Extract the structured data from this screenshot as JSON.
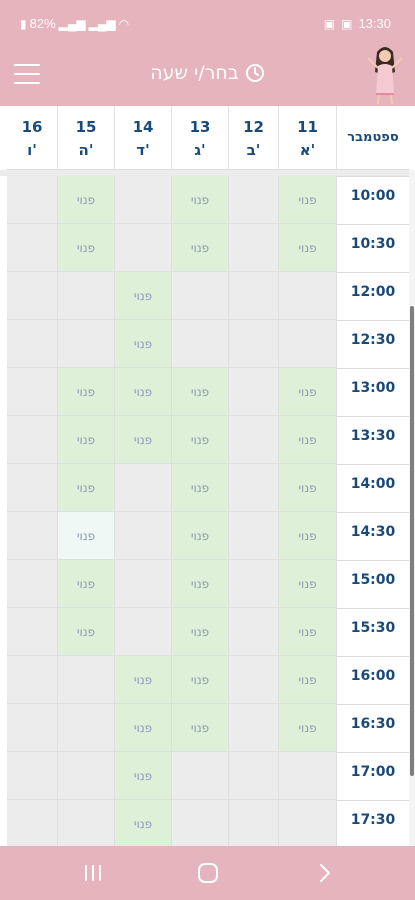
{
  "status_bar": {
    "battery": "82%",
    "clock": "13:30",
    "icons": [
      "battery-icon",
      "signal-icon",
      "signal-icon",
      "wifi-icon",
      "notification-icon",
      "image-icon"
    ]
  },
  "app_bar": {
    "title": "בחר/י שעה",
    "icons": [
      "menu-icon",
      "clock-icon",
      "avatar"
    ]
  },
  "calendar": {
    "month": "ספטמבר",
    "days": [
      {
        "num": "11",
        "day": "א'"
      },
      {
        "num": "12",
        "day": "ב'"
      },
      {
        "num": "13",
        "day": "ג'"
      },
      {
        "num": "14",
        "day": "ד'"
      },
      {
        "num": "15",
        "day": "ה'"
      },
      {
        "num": "16",
        "day": "ו'"
      }
    ],
    "free_label": "פנוי",
    "times": [
      "10:00",
      "10:30",
      "12:00",
      "12:30",
      "13:00",
      "13:30",
      "14:00",
      "14:30",
      "15:00",
      "15:30",
      "16:00",
      "16:30",
      "17:00",
      "17:30"
    ],
    "grid": [
      [
        1,
        0,
        1,
        0,
        1,
        0
      ],
      [
        1,
        0,
        1,
        0,
        1,
        0
      ],
      [
        0,
        0,
        0,
        1,
        0,
        0
      ],
      [
        0,
        0,
        0,
        1,
        0,
        0
      ],
      [
        1,
        0,
        1,
        1,
        1,
        0
      ],
      [
        1,
        0,
        1,
        1,
        1,
        0
      ],
      [
        1,
        0,
        1,
        0,
        1,
        0
      ],
      [
        1,
        0,
        1,
        0,
        2,
        0
      ],
      [
        1,
        0,
        1,
        0,
        1,
        0
      ],
      [
        1,
        0,
        1,
        0,
        1,
        0
      ],
      [
        1,
        0,
        1,
        1,
        0,
        0
      ],
      [
        1,
        0,
        1,
        1,
        0,
        0
      ],
      [
        0,
        0,
        0,
        1,
        0,
        0
      ],
      [
        0,
        0,
        0,
        1,
        0,
        0
      ]
    ]
  },
  "nav_bar": {
    "icons": [
      "recent-apps-icon",
      "home-icon",
      "back-icon"
    ]
  },
  "colors": {
    "brand": "#e5b4bc",
    "free": "#dff0d8",
    "selected": "#eef8f4",
    "empty": "#ececec",
    "text": "#1a4a7a"
  }
}
